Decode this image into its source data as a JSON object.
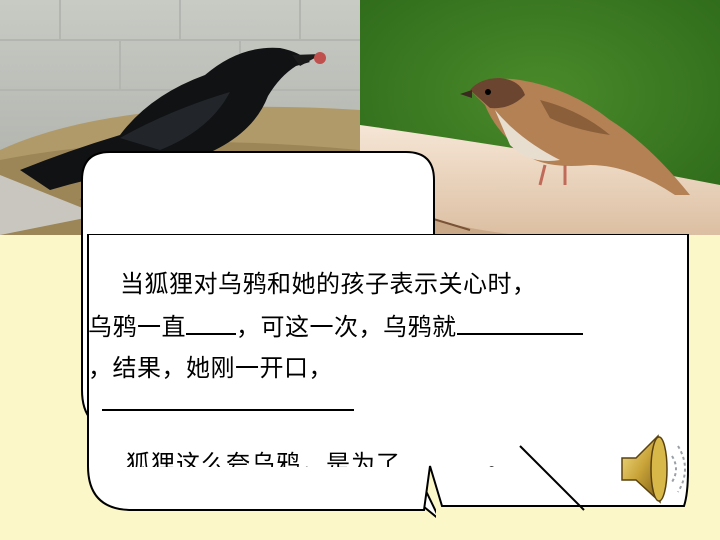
{
  "photos": {
    "left": {
      "icon": "crow-photo"
    },
    "right": {
      "icon": "sparrow-photo"
    }
  },
  "bubble": {
    "line1": "当狐狸对乌鸦和她的孩子表示关心时，",
    "line2_a": "乌鸦一直",
    "line2_b": "，可这一次，乌鸦就",
    "line3": "，结果，她刚一开口，"
  },
  "hidden_question": {
    "text_a": "狐狸这么夸乌鸦，是为了",
    "text_b": "。"
  },
  "audio": {
    "icon": "speaker-icon"
  }
}
